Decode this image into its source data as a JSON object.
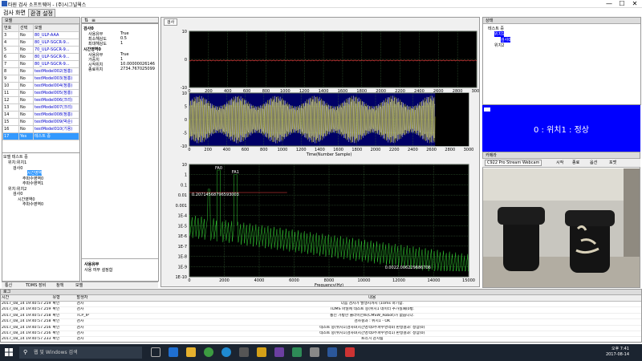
{
  "window": {
    "title": "타원 검사 소프트웨어 - (주)시그널웍스",
    "minimize": "—",
    "maximize": "☐",
    "close": "✕"
  },
  "menu": {
    "items": [
      "검사 화면",
      "환경 설정"
    ]
  },
  "model_panel": {
    "header": "모델",
    "columns": [
      "번호",
      "선택",
      "모델"
    ],
    "rows": [
      {
        "num": "3",
        "sel": "No",
        "model": "80_ULP-AAA"
      },
      {
        "num": "4",
        "sel": "No",
        "model": "80_ULP-SGCR-9..."
      },
      {
        "num": "5",
        "sel": "No",
        "model": "70_ULP-SGCR-9..."
      },
      {
        "num": "6",
        "sel": "No",
        "model": "80_ULP-SGCR-9..."
      },
      {
        "num": "7",
        "sel": "No",
        "model": "80_ULP-SGCR-9..."
      },
      {
        "num": "8",
        "sel": "No",
        "model": "testModel002(정홍)"
      },
      {
        "num": "9",
        "sel": "No",
        "model": "testModel003(정홍)"
      },
      {
        "num": "10",
        "sel": "No",
        "model": "testModel004(정홍)"
      },
      {
        "num": "11",
        "sel": "No",
        "model": "testModel005(정홍)"
      },
      {
        "num": "12",
        "sel": "No",
        "model": "testModel006(크리)"
      },
      {
        "num": "13",
        "sel": "No",
        "model": "testModel007(크리)"
      },
      {
        "num": "14",
        "sel": "No",
        "model": "testModel008(정홍)"
      },
      {
        "num": "15",
        "sel": "No",
        "model": "testModel009(박순)"
      },
      {
        "num": "16",
        "sel": "No",
        "model": "testModel010(기용)"
      },
      {
        "num": "17",
        "sel": "Yes",
        "model": "테스트 중"
      }
    ]
  },
  "model_tree": {
    "header": "모델 테스트 중",
    "nodes": [
      "위치:위치1",
      "검사0",
      "시간영역",
      "주파수영역0",
      "주파수영역1",
      "위치:위치2",
      "검사0",
      "시간영역0",
      "주파수영역0"
    ]
  },
  "bottom_tabs": [
    "통신",
    "TDMS 장비",
    "참책",
    "모델"
  ],
  "properties": {
    "sections": [
      {
        "title": "검사0",
        "rows": [
          [
            "사용유무",
            "True"
          ],
          [
            "최소해상도",
            "0.5"
          ],
          [
            "최대해상도",
            "1"
          ]
        ]
      },
      {
        "title": "시간영역0",
        "rows": [
          [
            "사용유무",
            "True"
          ],
          [
            "가중치",
            "1"
          ],
          [
            "시작위치",
            "10.00000026146"
          ],
          [
            "종료위치",
            "2734.767025099"
          ]
        ]
      }
    ],
    "desc_title": "사용유무",
    "desc_text": "사용 여부 설정함"
  },
  "chart_tab": "검사",
  "charts": {
    "chart1": {
      "xticks": [
        "0",
        "200",
        "400",
        "600",
        "800",
        "1000",
        "1200",
        "1400",
        "1600",
        "1800",
        "2000",
        "2200",
        "2400",
        "2600",
        "2800",
        "3000"
      ],
      "yticks": [
        "10",
        "0",
        "-10"
      ]
    },
    "chart2": {
      "xticks": [
        "0",
        "200",
        "400",
        "600",
        "800",
        "1000",
        "1200",
        "1400",
        "1600",
        "1800",
        "2000",
        "2200",
        "2400",
        "2600",
        "2800",
        "3000"
      ],
      "yticks": [
        "10",
        "5",
        "0",
        "-5",
        "-10"
      ],
      "xlabel": "Time(Number Sample)"
    },
    "chart3": {
      "xticks": [
        "0",
        "2000",
        "4000",
        "6000",
        "8000",
        "10000",
        "12000",
        "14000",
        "15000"
      ],
      "yticks": [
        "10",
        "1",
        "0.1",
        "0.01",
        "0.001",
        "1E-4",
        "1E-5",
        "1E-6",
        "1E-7",
        "1E-8",
        "1E-9",
        "1E-10"
      ],
      "xlabel": "Frequency(Hz)",
      "ann1": "0.20714568796593003",
      "ann2": "0.0022.006229686706",
      "peak_labels": [
        "FA0",
        "FA1"
      ]
    }
  },
  "status_panel": {
    "header": "상태",
    "tree": [
      "테스트 중",
      "위치1",
      "검사0",
      "위치2"
    ]
  },
  "alert": {
    "message": "0 : 위치1 : 정상"
  },
  "camera": {
    "header": "카메라",
    "device": "C922 Pro Stream Webcam",
    "buttons": [
      "시작",
      "종료",
      "옵션",
      "포맷"
    ]
  },
  "log": {
    "header": "로그",
    "columns": [
      "시간",
      "유형",
      "발생자",
      "내용"
    ],
    "rows": [
      [
        "2017_08_14 19:40:57.259",
        "확인",
        "검사",
        "다음 검사가 발생시까지 (10ms 마기함."
      ],
      [
        "2017_08_14 19:40:57.259",
        "확인",
        "검사",
        "TDMS 파일에 테스트 중(위치1 데이터 추가실패(0방."
      ],
      [
        "2017_08_14 19:40:57.258",
        "확인",
        "TCP_IP",
        "통신 가방한 클라이언트(CMSW_Robot)가 없습니다."
      ],
      [
        "2017_08_14 19:40:57.258",
        "확인",
        "검사",
        "검사결과 : 위치1 - OK"
      ],
      [
        "2017_08_14 19:40:57.256",
        "확인",
        "검사",
        "테스트 중(위치1(검사0(시간영역0주파수영역0) 판정결과: 정상(0)"
      ],
      [
        "2017_08_14 19:40:57.256",
        "확인",
        "검사",
        "테스트 중(위치1(검사0(시간영역0주파수영역1) 판정결과: 정상(0)"
      ],
      [
        "2017_08_14 19:40:57.233",
        "확인",
        "검사",
        "트리거 감지됨"
      ]
    ]
  },
  "taskbar": {
    "search": "웹 및 Windows 검색",
    "time": "오후 7:41",
    "date": "2017-08-14"
  },
  "colors": {
    "alert_bg": "#0000ff",
    "selection": "#3399ff",
    "signal_white": "#ffffff",
    "signal_yellow": "#e6e600",
    "signal_green": "#33cc33",
    "chart_bg": "#000000",
    "chart2_bg": "#000066"
  }
}
